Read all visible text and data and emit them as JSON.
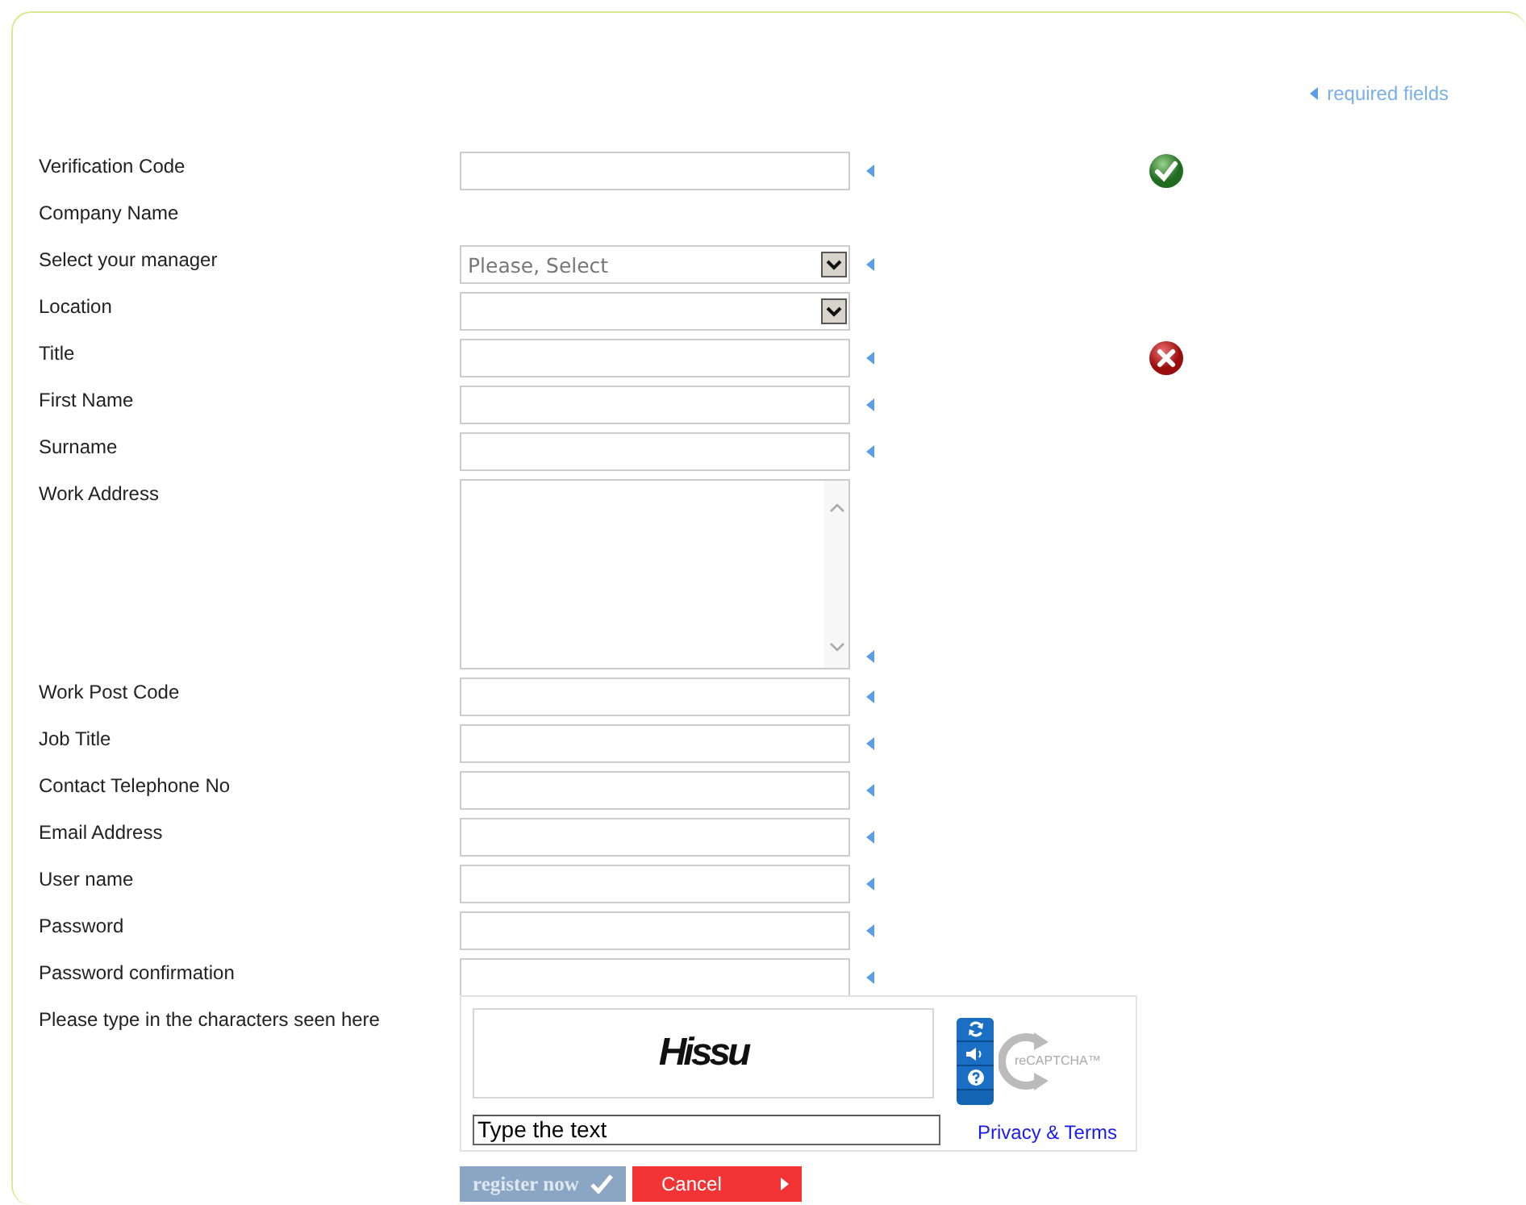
{
  "required_note": {
    "text": "required fields"
  },
  "rows": [
    {
      "label": "Verification Code",
      "kind": "text",
      "required": true,
      "valid": true
    },
    {
      "label": "Company Name",
      "kind": "none"
    },
    {
      "label": "Select your manager",
      "kind": "select",
      "value": "Please, Select",
      "required": true
    },
    {
      "label": "Location",
      "kind": "select",
      "required": false
    },
    {
      "label": "Title",
      "kind": "text",
      "required": true,
      "valid": false
    },
    {
      "label": "First Name",
      "kind": "text",
      "required": true
    },
    {
      "label": "Surname",
      "kind": "text",
      "required": true
    },
    {
      "label": "Work Address",
      "kind": "textarea",
      "required": true
    },
    {
      "label": "Work Post Code",
      "kind": "text",
      "required": true
    },
    {
      "label": "Job Title",
      "kind": "text",
      "required": true
    },
    {
      "label": "Contact Telephone No",
      "kind": "text",
      "required": true
    },
    {
      "label": "Email Address",
      "kind": "text",
      "required": true
    },
    {
      "label": "User name",
      "kind": "text",
      "required": true
    },
    {
      "label": "Password",
      "kind": "text",
      "required": true
    },
    {
      "label": "Password confirmation",
      "kind": "text",
      "required": true
    }
  ],
  "captcha": {
    "label": "Please type in the characters seen here",
    "challenge": "Hissu",
    "value": "Type the text",
    "logo_text": "reCAPTCHA™",
    "link": "Privacy & Terms"
  },
  "buttons": [
    {
      "label": "register now",
      "kind": "submit"
    },
    {
      "label": "Cancel",
      "kind": "cancel"
    }
  ]
}
